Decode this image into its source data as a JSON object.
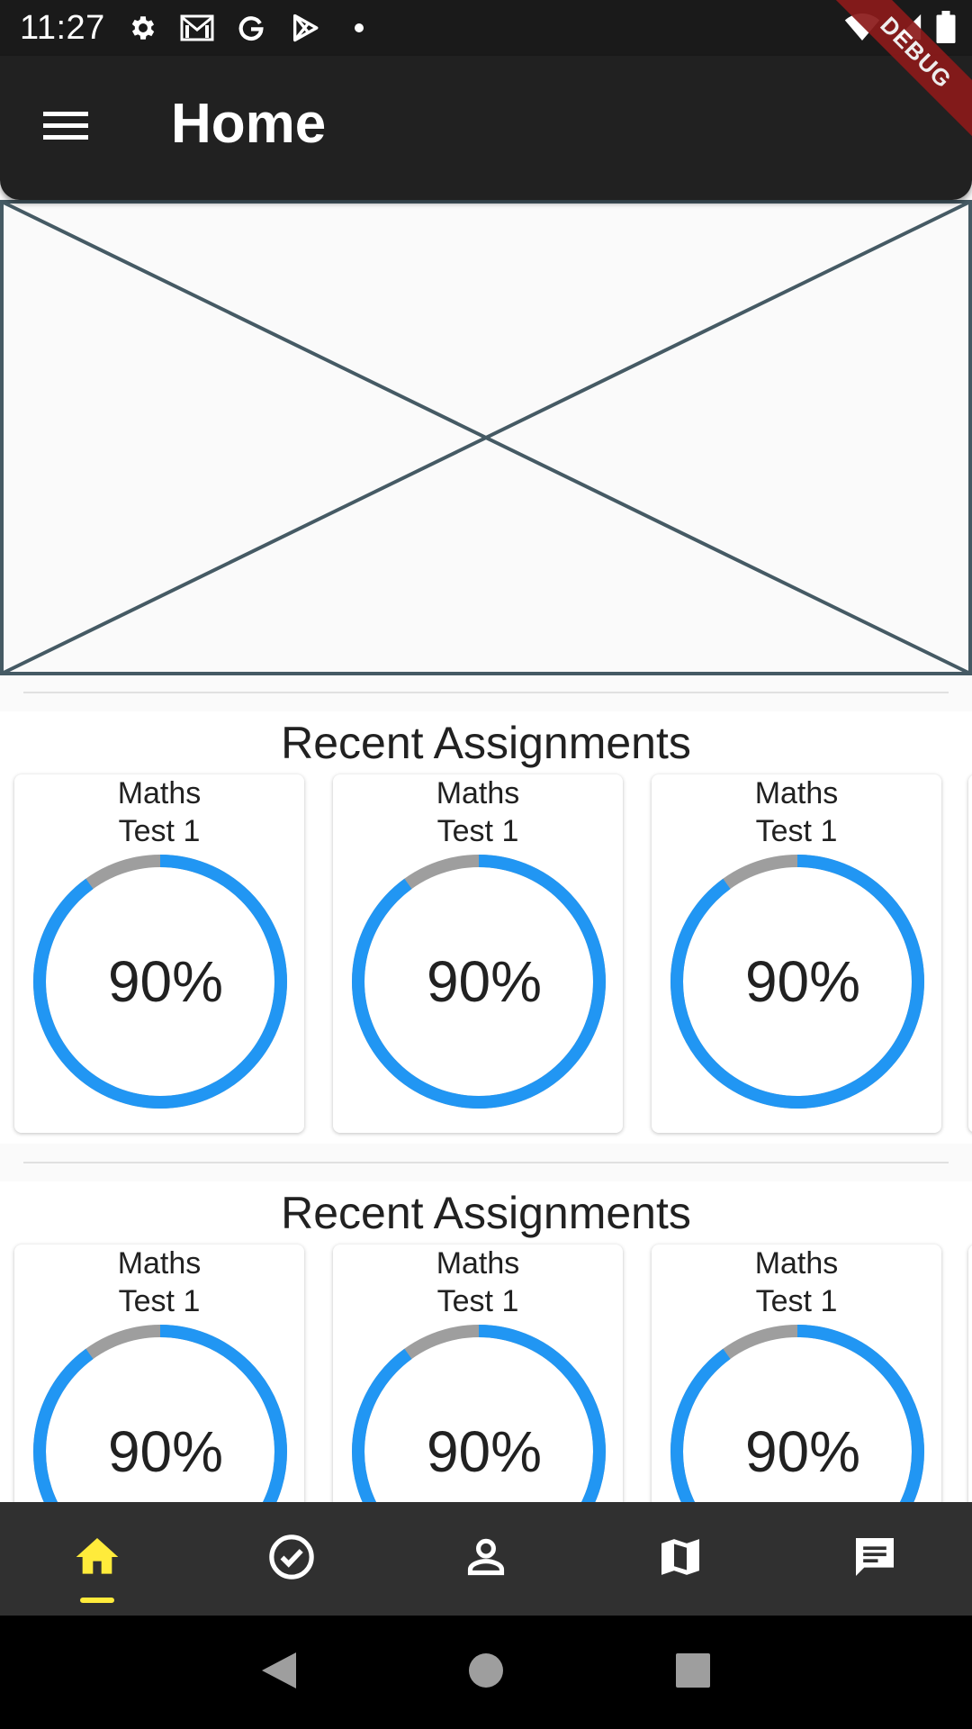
{
  "status_bar": {
    "time": "11:27",
    "left_icons": [
      "settings-icon",
      "gmail-icon",
      "google-icon",
      "play-store-icon",
      "dot-icon"
    ],
    "right_icons": [
      "wifi-icon",
      "signal-icon",
      "battery-icon"
    ]
  },
  "debug_banner": "DEBUG",
  "app_bar": {
    "title": "Home",
    "menu_icon": "menu-icon"
  },
  "sections": [
    {
      "title": "Recent Assignments",
      "cards": [
        {
          "subject": "Maths",
          "name": "Test 1",
          "score_label": "90%",
          "score": 0.9
        },
        {
          "subject": "Maths",
          "name": "Test 1",
          "score_label": "90%",
          "score": 0.9
        },
        {
          "subject": "Maths",
          "name": "Test 1",
          "score_label": "90%",
          "score": 0.9
        }
      ]
    },
    {
      "title": "Recent Assignments",
      "cards": [
        {
          "subject": "Maths",
          "name": "Test 1",
          "score_label": "90%",
          "score": 0.9
        },
        {
          "subject": "Maths",
          "name": "Test 1",
          "score_label": "90%",
          "score": 0.9
        },
        {
          "subject": "Maths",
          "name": "Test 1",
          "score_label": "90%",
          "score": 0.9
        }
      ]
    }
  ],
  "bottom_nav": {
    "items": [
      {
        "icon": "home-icon",
        "active": true
      },
      {
        "icon": "check-circle-icon",
        "active": false
      },
      {
        "icon": "person-icon",
        "active": false
      },
      {
        "icon": "map-icon",
        "active": false
      },
      {
        "icon": "chat-icon",
        "active": false
      }
    ]
  },
  "system_nav": [
    "back-icon",
    "home-circle-icon",
    "recents-icon"
  ],
  "colors": {
    "app_bar": "#212121",
    "progress": "#2196f3",
    "track": "#9e9e9e",
    "active_nav": "#ffeb3b",
    "bottom_nav": "#303030",
    "placeholder_stroke": "#455a64"
  }
}
